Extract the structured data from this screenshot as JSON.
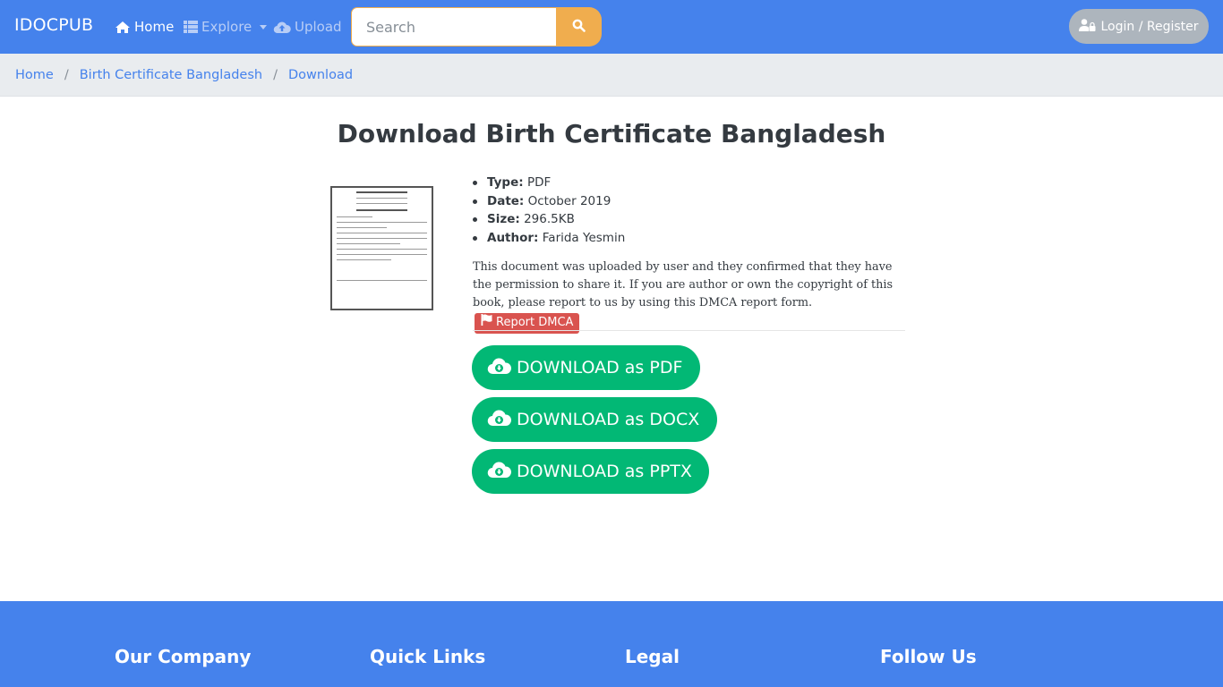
{
  "navbar": {
    "brand": "IDOCPUB",
    "items": [
      {
        "label": "Home",
        "icon": "home-icon",
        "active": true
      },
      {
        "label": "Explore",
        "icon": "grid-icon",
        "dropdown": true
      },
      {
        "label": "Upload",
        "icon": "cloud-upload-icon"
      }
    ],
    "search": {
      "placeholder": "Search",
      "value": "",
      "button_icon": "search-icon"
    },
    "login": {
      "label": "Login / Register",
      "icon": "user-lock-icon"
    }
  },
  "breadcrumb": [
    "Home",
    "Birth Certificate Bangladesh",
    "Download"
  ],
  "main": {
    "title": "Download Birth Certificate Bangladesh",
    "meta": [
      {
        "key": "Type:",
        "value": "PDF"
      },
      {
        "key": "Date:",
        "value": "October 2019"
      },
      {
        "key": "Size:",
        "value": "296.5KB"
      },
      {
        "key": "Author:",
        "value": "Farida Yesmin"
      }
    ],
    "notice": "This document was uploaded by user and they confirmed that they have the permission to share it. If you are author or own the copyright of this book, please report to us by using this DMCA report form.",
    "report_button": "Report DMCA",
    "downloads": [
      "DOWNLOAD as PDF",
      "DOWNLOAD as DOCX",
      "DOWNLOAD as PPTX"
    ]
  },
  "footer": {
    "headings": [
      "Our Company",
      "Quick Links",
      "Legal",
      "Follow Us"
    ]
  },
  "colors": {
    "primary": "#4582ec",
    "warning": "#f0ad4e",
    "success": "#02b875",
    "danger": "#d9534f",
    "secondary": "#adb5bd"
  }
}
